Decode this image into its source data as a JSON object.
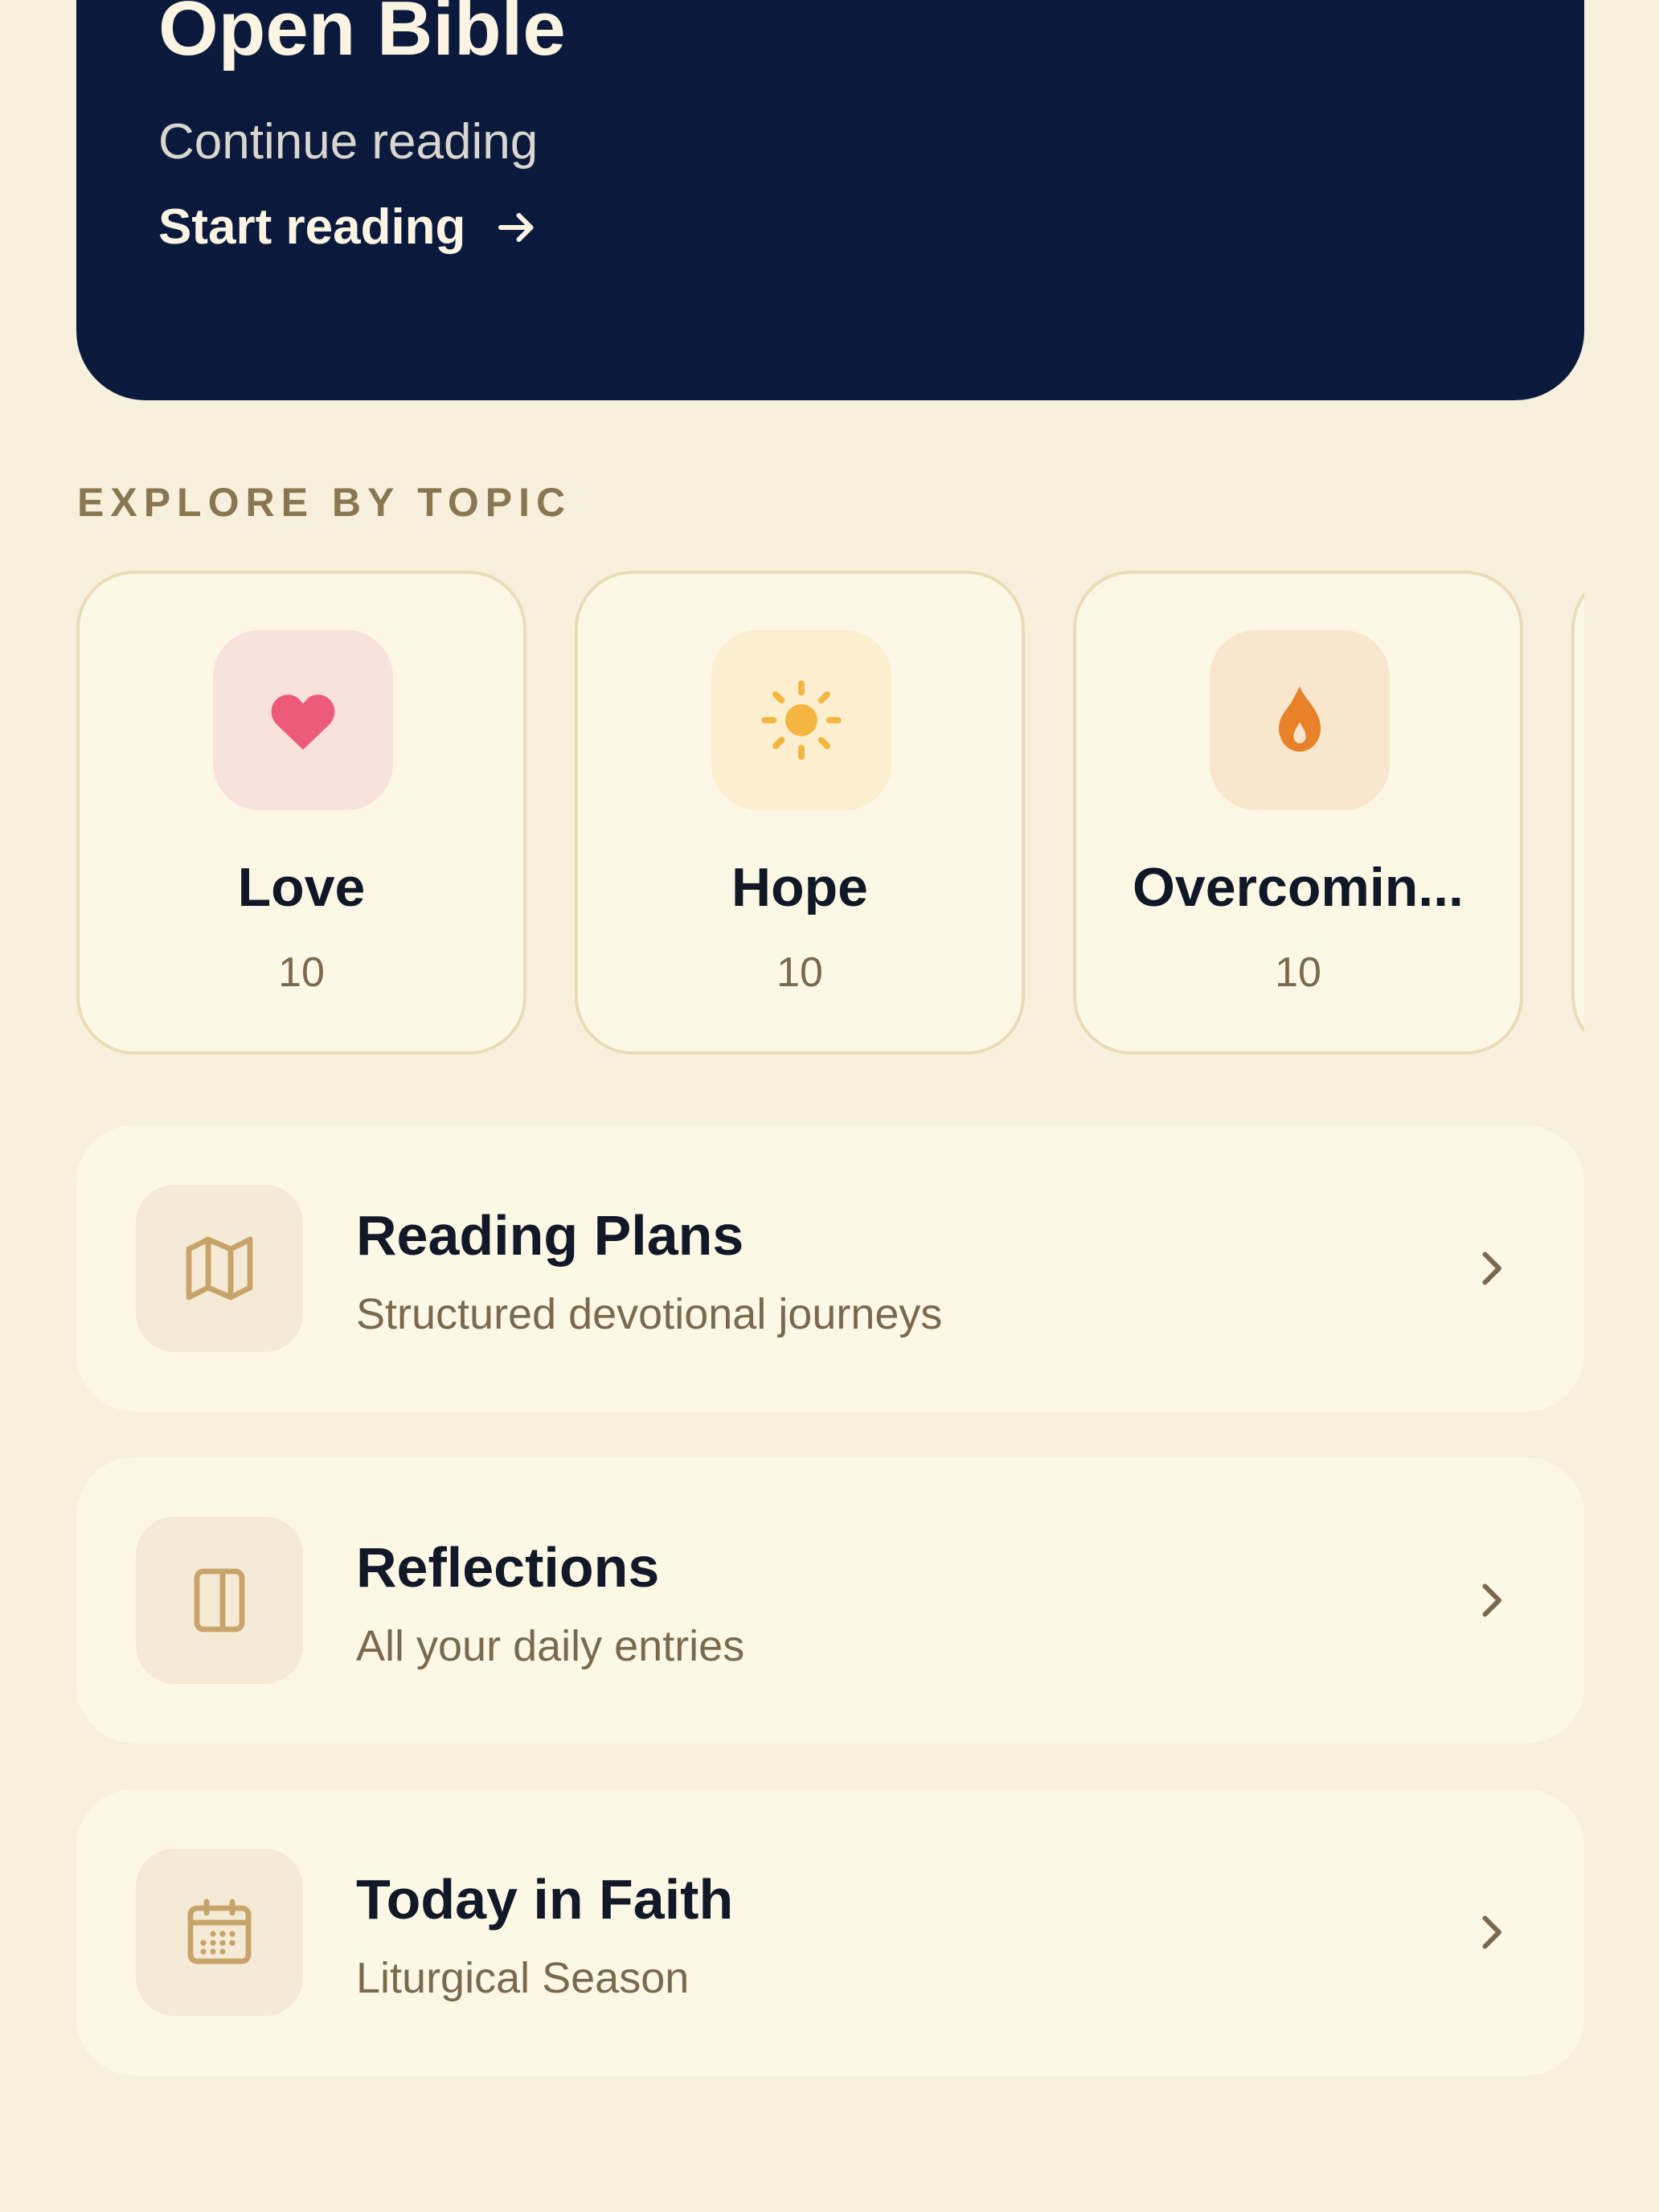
{
  "hero": {
    "title": "Open Bible",
    "subtitle": "Continue reading",
    "cta_label": "Start reading",
    "background": "#0b1a3c"
  },
  "topics_section": {
    "label": "EXPLORE BY TOPIC"
  },
  "topics": [
    {
      "name": "Love",
      "count": "10",
      "icon": "heart-icon",
      "icon_color": "#ec5b7a",
      "tile_color": "#f9e2db"
    },
    {
      "name": "Hope",
      "count": "10",
      "icon": "sun-icon",
      "icon_color": "#f4b640",
      "tile_color": "#fbefcf"
    },
    {
      "name": "Overcomin...",
      "count": "10",
      "icon": "flame-icon",
      "icon_color": "#e8822a",
      "tile_color": "#f9e6cc"
    }
  ],
  "links": [
    {
      "title": "Reading Plans",
      "subtitle": "Structured devotional journeys",
      "icon": "map-icon"
    },
    {
      "title": "Reflections",
      "subtitle": "All your daily entries",
      "icon": "journal-icon"
    },
    {
      "title": "Today in Faith",
      "subtitle": "Liturgical Season",
      "icon": "calendar-icon"
    }
  ],
  "colors": {
    "page_background": "#f7f0dc",
    "card_background": "#fdf7e6",
    "accent_brown": "#8a7752",
    "icon_gold": "#c7a46a"
  }
}
